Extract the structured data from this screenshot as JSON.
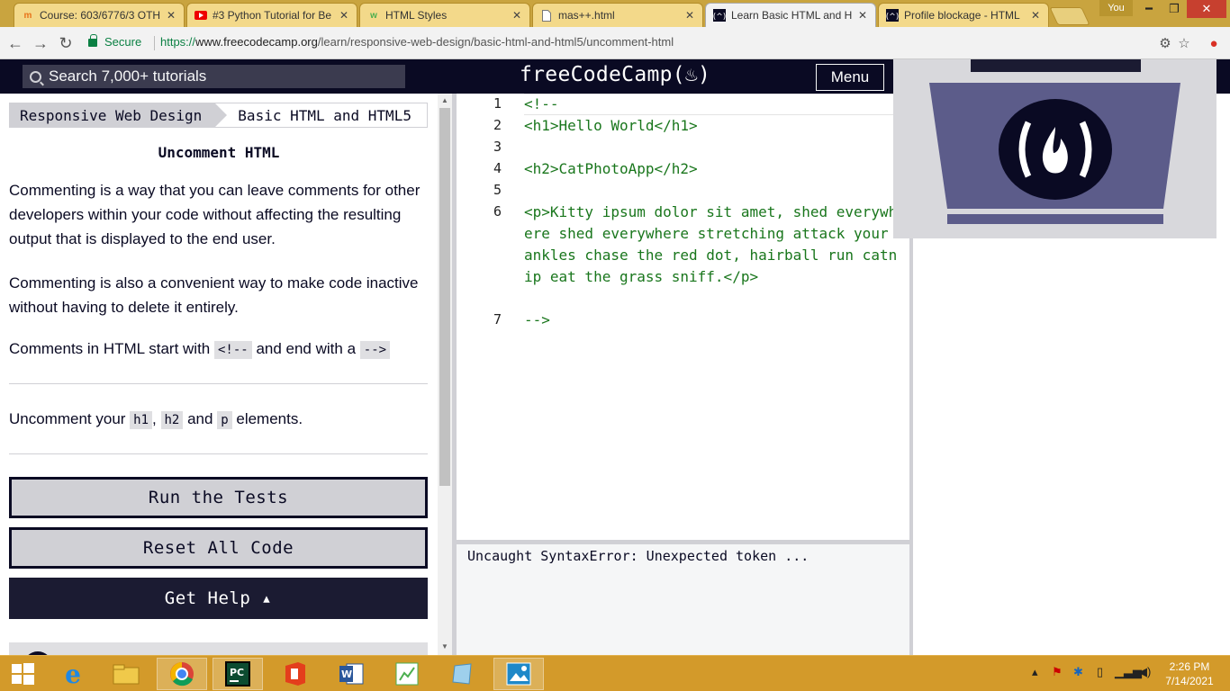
{
  "browser": {
    "tabs": [
      {
        "label": "Course: 603/6776/3 OTH",
        "icon": "moodle-icon"
      },
      {
        "label": "#3 Python Tutorial for Be",
        "icon": "youtube-icon"
      },
      {
        "label": "HTML Styles",
        "icon": "w3schools-icon"
      },
      {
        "label": "mas++.html",
        "icon": "document-icon"
      },
      {
        "label": "Learn Basic HTML and H",
        "icon": "freecodecamp-icon",
        "active": true
      },
      {
        "label": "Profile blockage - HTML",
        "icon": "freecodecamp-icon"
      }
    ],
    "profile_label": "You",
    "secure_label": "Secure",
    "url_proto": "https://",
    "url_host": "www.freecodecamp.org",
    "url_path": "/learn/responsive-web-design/basic-html-and-html5/uncomment-html"
  },
  "header": {
    "search_placeholder": "Search 7,000+ tutorials",
    "logo": "freeCodeCamp(♨)",
    "menu_label": "Menu"
  },
  "lesson": {
    "breadcrumb_1": "Responsive Web Design",
    "breadcrumb_2": "Basic HTML and HTML5",
    "title": "Uncomment HTML",
    "para1": "Commenting is a way that you can leave comments for other developers within your code without affecting the resulting output that is displayed to the end user.",
    "para2": "Commenting is also a convenient way to make code inactive without having to delete it entirely.",
    "para3_a": "Comments in HTML start with",
    "para3_code1": "<!--",
    "para3_b": "and end with a",
    "para3_code2": "-->",
    "task_a": "Uncomment your",
    "task_h1": "h1",
    "task_comma": ",",
    "task_h2": "h2",
    "task_and": "and",
    "task_p": "p",
    "task_b": "elements.",
    "run_label": "Run the Tests",
    "reset_label": "Reset All Code",
    "help_label": "Get Help ▴"
  },
  "editor": {
    "lines": [
      {
        "num": "1",
        "code": "<!--"
      },
      {
        "num": "2",
        "code": "<h1>Hello World</h1>"
      },
      {
        "num": "3",
        "code": ""
      },
      {
        "num": "4",
        "code": "<h2>CatPhotoApp</h2>"
      },
      {
        "num": "5",
        "code": ""
      },
      {
        "num": "6",
        "code": "<p>Kitty ipsum dolor sit amet, shed everywhere shed everywhere stretching attack your ankles chase the red dot, hairball run catnip eat the grass sniff.</p>"
      },
      {
        "num": "7",
        "code": "-->"
      }
    ],
    "console_output": "Uncaught SyntaxError: Unexpected token ..."
  },
  "taskbar": {
    "time": "2:26 PM",
    "date": "7/14/2021"
  },
  "colors": {
    "fcc_dark": "#0a0a23",
    "code_green": "#19761c",
    "taskbar": "#d39a2a"
  }
}
